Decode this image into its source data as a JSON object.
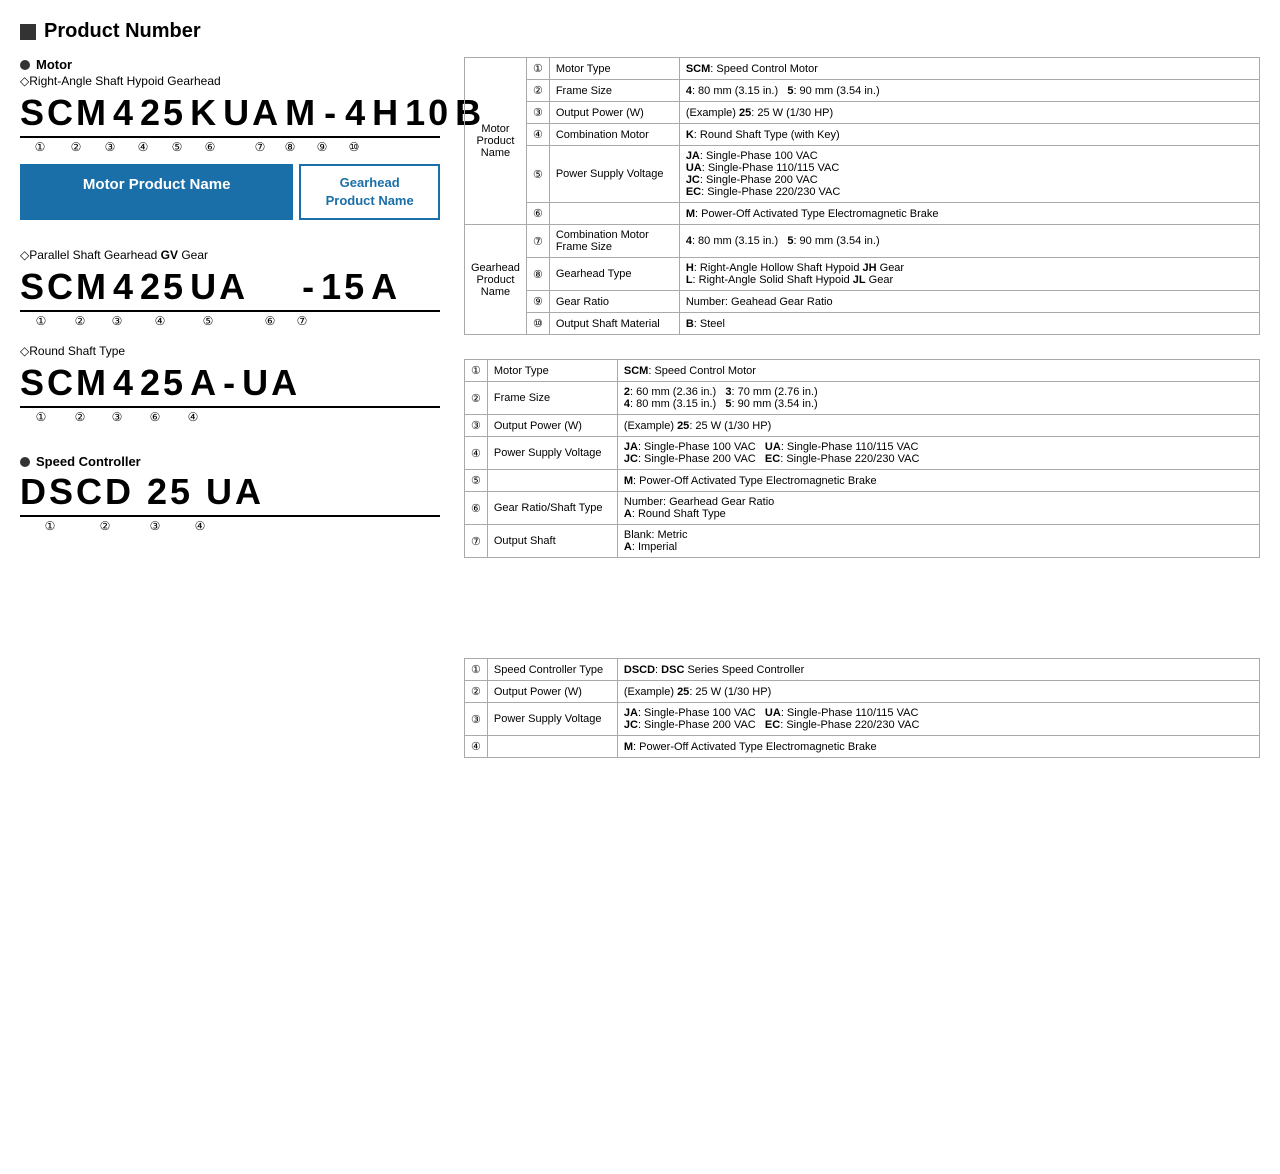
{
  "page": {
    "title": "Product Number"
  },
  "motor_section": {
    "label": "Motor",
    "subsections": [
      {
        "type": "Right-Angle Shaft Hypoid Gearhead",
        "code_parts": [
          "SCM",
          "4",
          "25",
          "K",
          "UA",
          "M",
          "-",
          "4",
          "H",
          "10",
          "B"
        ],
        "circle_positions": [
          "①",
          "②",
          "③",
          "④",
          "⑤",
          "⑥",
          "",
          "⑦",
          "⑧",
          "⑨",
          "⑩"
        ],
        "motor_name_box": "Motor Product Name",
        "gearhead_name_box": "Gearhead\nProduct Name"
      }
    ]
  },
  "table1": {
    "group_labels": {
      "motor": "Motor\nProduct\nName",
      "gearhead": "Gearhead\nProduct\nName"
    },
    "rows": [
      {
        "num": "①",
        "group": "motor",
        "label": "Motor Type",
        "value": "<b>SCM</b>: Speed Control Motor"
      },
      {
        "num": "②",
        "group": "motor",
        "label": "Frame Size",
        "value": "<b>4</b>: 80 mm (3.15 in.)    <b>5</b>: 90 mm (3.54 in.)"
      },
      {
        "num": "③",
        "group": "motor",
        "label": "Output Power (W)",
        "value": "(Example) <b>25</b>: 25 W (1/30 HP)"
      },
      {
        "num": "④",
        "group": "motor",
        "label": "Combination Motor",
        "value": "<b>K</b>: Round Shaft Type (with Key)"
      },
      {
        "num": "⑤",
        "group": "motor",
        "label": "Power Supply Voltage",
        "value": "<b>JA</b>: Single-Phase 100 VAC<br><b>UA</b>: Single-Phase 110/115 VAC<br><b>JC</b>: Single-Phase 200 VAC<br><b>EC</b>: Single-Phase 220/230 VAC"
      },
      {
        "num": "⑥",
        "group": "motor",
        "label": "",
        "value": "<b>M</b>: Power-Off Activated Type Electromagnetic Brake"
      },
      {
        "num": "⑦",
        "group": "gearhead",
        "label": "Combination Motor Frame Size",
        "value": "<b>4</b>: 80 mm (3.15 in.)    <b>5</b>: 90 mm (3.54 in.)"
      },
      {
        "num": "⑧",
        "group": "gearhead",
        "label": "Gearhead Type",
        "value": "<b>H</b>: Right-Angle Hollow Shaft Hypoid <b>JH</b> Gear<br><b>L</b>: Right-Angle Solid Shaft Hypoid <b>JL</b> Gear"
      },
      {
        "num": "⑨",
        "group": "gearhead",
        "label": "Gear Ratio",
        "value": "Number: Geahead Gear Ratio"
      },
      {
        "num": "⑩",
        "group": "gearhead",
        "label": "Output Shaft Material",
        "value": "<b>B</b>: Steel"
      }
    ]
  },
  "parallel_section": {
    "type": "Parallel Shaft Gearhead GV Gear",
    "code": "SCM 4 25 UA   - 15 A",
    "circles": "①  ②  ③  ④  ⑤      ⑥  ⑦"
  },
  "table2": {
    "rows": [
      {
        "num": "①",
        "label": "Motor Type",
        "value": "<b>SCM</b>: Speed Control Motor"
      },
      {
        "num": "②",
        "label": "Frame Size",
        "value": "<b>2</b>: 60 mm (2.36 in.)   <b>3</b>: 70 mm (2.76 in.)<br><b>4</b>: 80 mm (3.15 in.)   <b>5</b>: 90 mm (3.54 in.)"
      },
      {
        "num": "③",
        "label": "Output Power (W)",
        "value": "(Example) <b>25</b>: 25 W (1/30 HP)"
      },
      {
        "num": "④",
        "label": "Power Supply Voltage",
        "value": "<b>JA</b>: Single-Phase 100 VAC    <b>UA</b>: Single-Phase 110/115 VAC<br><b>JC</b>: Single-Phase 200 VAC    <b>EC</b>: Single-Phase 220/230 VAC"
      },
      {
        "num": "⑤",
        "label": "",
        "value": "<b>M</b>: Power-Off Activated Type Electromagnetic Brake"
      },
      {
        "num": "⑥",
        "label": "Gear Ratio/Shaft Type",
        "value": "Number: Gearhead Gear Ratio<br><b>A</b>: Round Shaft Type"
      },
      {
        "num": "⑦",
        "label": "Output Shaft",
        "value": "Blank: Metric<br><b>A</b>: Imperial"
      }
    ]
  },
  "round_section": {
    "type": "Round Shaft Type",
    "code": "SCM 4 25 A - UA",
    "circles": "①  ②  ③  ⑥    ④"
  },
  "speed_controller": {
    "label": "Speed Controller",
    "code": "DSCD 25 UA",
    "circles": "①       ②    ③    ④"
  },
  "table3": {
    "rows": [
      {
        "num": "①",
        "label": "Speed Controller Type",
        "value": "<b>DSCD</b>: <b>DSC</b> Series Speed Controller"
      },
      {
        "num": "②",
        "label": "Output Power (W)",
        "value": "(Example) <b>25</b>: 25 W (1/30 HP)"
      },
      {
        "num": "③",
        "label": "Power Supply Voltage",
        "value": "<b>JA</b>: Single-Phase 100 VAC    <b>UA</b>: Single-Phase 110/115 VAC<br><b>JC</b>: Single-Phase 200 VAC    <b>EC</b>: Single-Phase 220/230 VAC"
      },
      {
        "num": "④",
        "label": "",
        "value": "<b>M</b>: Power-Off Activated Type Electromagnetic Brake"
      }
    ]
  }
}
